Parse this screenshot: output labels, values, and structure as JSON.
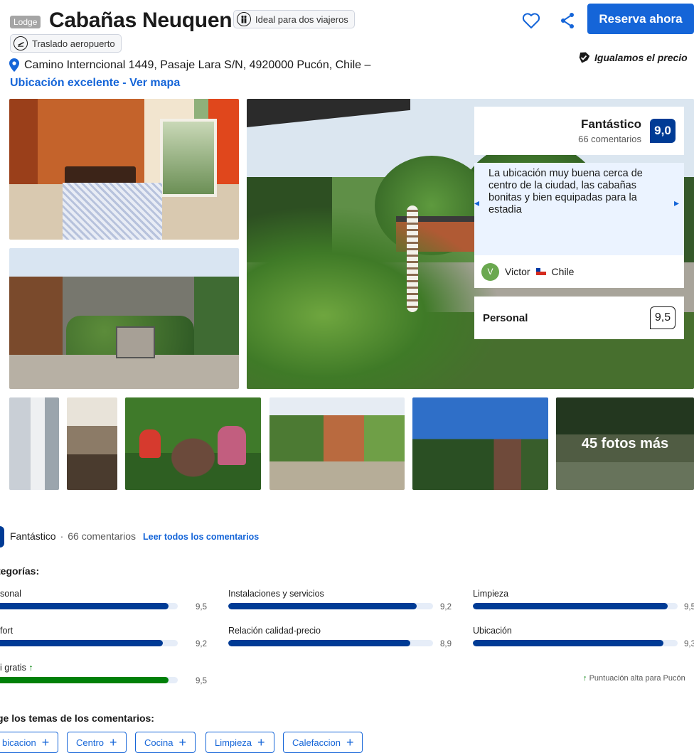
{
  "header": {
    "badge": "Lodge",
    "name": "Cabañas Neuquen",
    "ideal_label": "Ideal para dos viajeros",
    "traslado_label": "Traslado aeropuerto",
    "reserve_label": "Reserva ahora",
    "price_match": "Igualamos el precio",
    "address": "Camino Interncional 1449, Pasaje Lara S/N, 4920000 Pucón, Chile –",
    "map_link": "Ubicación excelente - Ver mapa",
    "icons": [
      "ideal-travelers-icon",
      "airport-shuttle-icon",
      "heart-icon",
      "share-icon",
      "shield-check-icon",
      "location-pin-icon"
    ]
  },
  "review_card": {
    "word": "Fantástico",
    "count": "66 comentarios",
    "score": "9,0",
    "quote": "La ubicación muy buena cerca de centro de la ciudad, las cabañas bonitas y bien equipadas para la estadia",
    "author_initial": "V",
    "author_name": "Victor",
    "author_country": "Chile",
    "category_label": "Personal",
    "category_score": "9,5"
  },
  "gallery": {
    "more_photos": "45 fotos más"
  },
  "summary": {
    "word": "Fantástico",
    "separator": "·",
    "count": "66 comentarios",
    "read_all": "Leer todos los comentarios",
    "categories_title": "tegorías:",
    "topics_title": "ge los temas de los comentarios:",
    "high_score_note": "Puntuación alta para Pucón"
  },
  "categories": [
    {
      "label": "sonal",
      "score": "9,5",
      "value": 9.5,
      "green": false
    },
    {
      "label": "Instalaciones y servicios",
      "score": "9,2",
      "value": 9.2,
      "green": false
    },
    {
      "label": "Limpieza",
      "score": "9,5",
      "value": 9.5,
      "green": false
    },
    {
      "label": "fort",
      "score": "9,2",
      "value": 9.2,
      "green": false
    },
    {
      "label": "Relación calidad-precio",
      "score": "8,9",
      "value": 8.9,
      "green": false
    },
    {
      "label": "Ubicación",
      "score": "9,3",
      "value": 9.3,
      "green": false
    },
    {
      "label": "i gratis",
      "score": "9,5",
      "value": 9.5,
      "green": true
    }
  ],
  "topics": [
    "bicacion",
    "Centro",
    "Cocina",
    "Limpieza",
    "Calefaccion"
  ],
  "colors": {
    "brand_blue": "#003b95",
    "action_blue": "#1565d8",
    "green": "#008009"
  }
}
